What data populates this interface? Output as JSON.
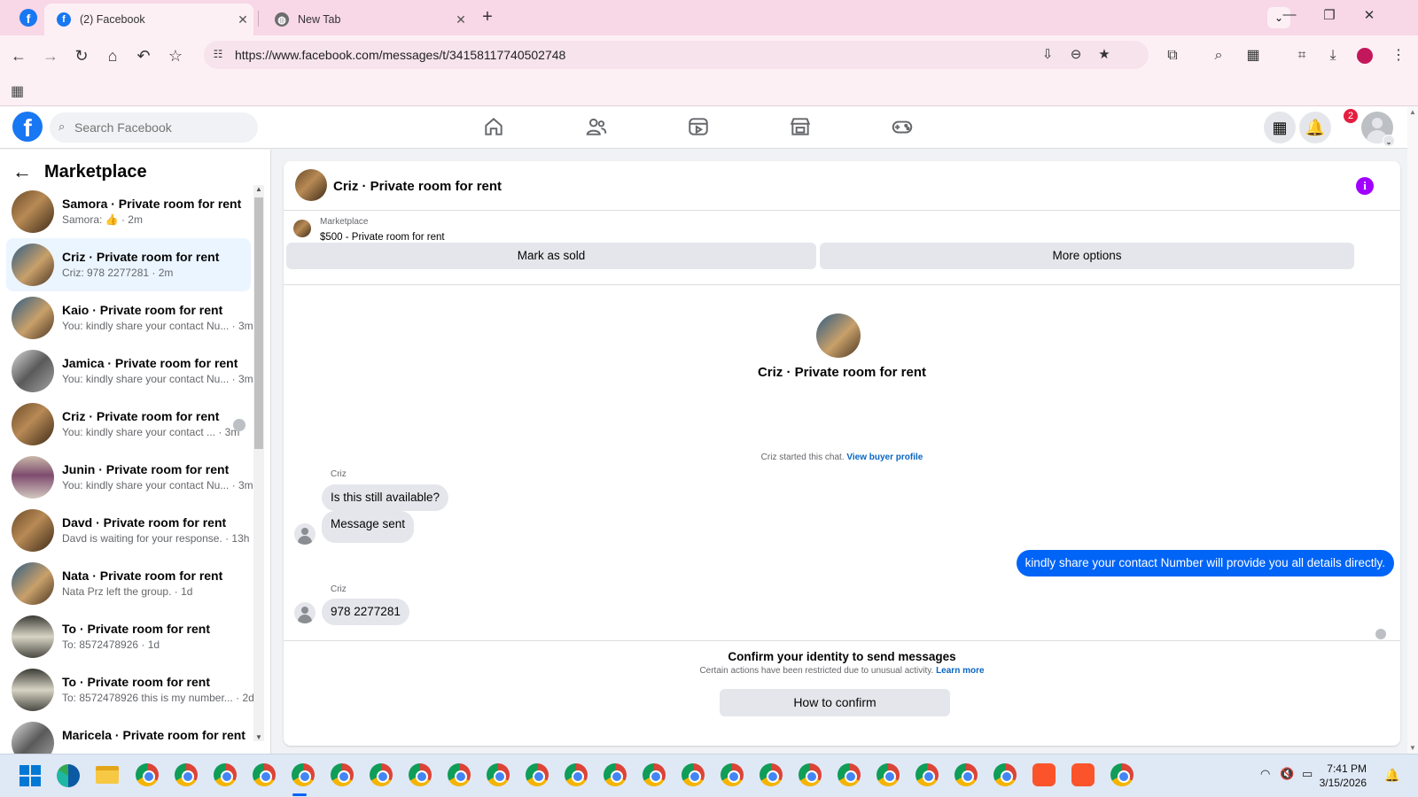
{
  "browser": {
    "tabs": [
      {
        "label": "(2) Facebook",
        "active": true
      },
      {
        "label": "New Tab",
        "active": false
      }
    ],
    "url": "https://www.facebook.com/messages/t/34158117740502748",
    "new_tab_label": "+"
  },
  "fb_header": {
    "logo": "f",
    "search_placeholder": "Search Facebook",
    "notification_count": "2",
    "nav_icons": [
      "home-icon",
      "friends-icon",
      "video-icon",
      "marketplace-icon",
      "gaming-icon"
    ]
  },
  "sidebar": {
    "title": "Marketplace",
    "conversations": [
      {
        "name": "Samora · Private room for rent",
        "snippet": "Samora: 👍 · 2m",
        "selected": false
      },
      {
        "name": "Criz · Private room for rent",
        "snippet": "Criz: 978 2277281 · 2m",
        "selected": true
      },
      {
        "name": "Kaio · Private room for rent",
        "snippet": "You: kindly share your contact Nu... · 3m",
        "selected": false
      },
      {
        "name": "Jamica · Private room for rent",
        "snippet": "You: kindly share your contact Nu... · 3m",
        "selected": false
      },
      {
        "name": "Criz · Private room for rent",
        "snippet": "You: kindly share your contact ... · 3m",
        "selected": false
      },
      {
        "name": "Junin · Private room for rent",
        "snippet": "You: kindly share your contact Nu... · 3m",
        "selected": false
      },
      {
        "name": "Davd · Private room for rent",
        "snippet": "Davd is waiting for your response. · 13h",
        "selected": false
      },
      {
        "name": "Nata · Private room for rent",
        "snippet": "Nata Prz left the group. · 1d",
        "selected": false
      },
      {
        "name": "To · Private room for rent",
        "snippet": "To: 8572478926 · 1d",
        "selected": false
      },
      {
        "name": "To · Private room for rent",
        "snippet": "To: 8572478926 this is my number... · 2d",
        "selected": false
      },
      {
        "name": "Maricela · Private room for rent",
        "snippet": "",
        "selected": false
      }
    ]
  },
  "chat": {
    "title": "Criz · Private room for rent",
    "listing_source": "Marketplace",
    "listing_price": "$500 - Private room for rent",
    "mark_sold_label": "Mark as sold",
    "more_options_label": "More options",
    "center_title": "Criz · Private room for rent",
    "started_text": "Criz started this chat.",
    "view_profile_label": "View buyer profile",
    "messages": [
      {
        "sender": "Criz",
        "text": "Is this still available?",
        "direction": "in"
      },
      {
        "sender": "",
        "text": "Message sent",
        "direction": "in"
      },
      {
        "sender": "You",
        "text": "kindly share your contact Number will provide you all details directly.",
        "direction": "out"
      },
      {
        "sender": "Criz",
        "text": "978 2277281",
        "direction": "in"
      }
    ],
    "confirm_title": "Confirm your identity to send messages",
    "confirm_sub": "Certain actions have been restricted due to unusual activity.",
    "learn_more_label": "Learn more",
    "how_to_confirm_label": "How to confirm"
  },
  "taskbar": {
    "time": "7:41 PM",
    "date": "3/15/2026"
  },
  "colors": {
    "fb_blue": "#1877f2",
    "outgoing_bubble": "#0064f7",
    "tab_strip": "#f8d7e6",
    "notif_badge": "#e41e3f",
    "info_icon": "#a100ff"
  }
}
